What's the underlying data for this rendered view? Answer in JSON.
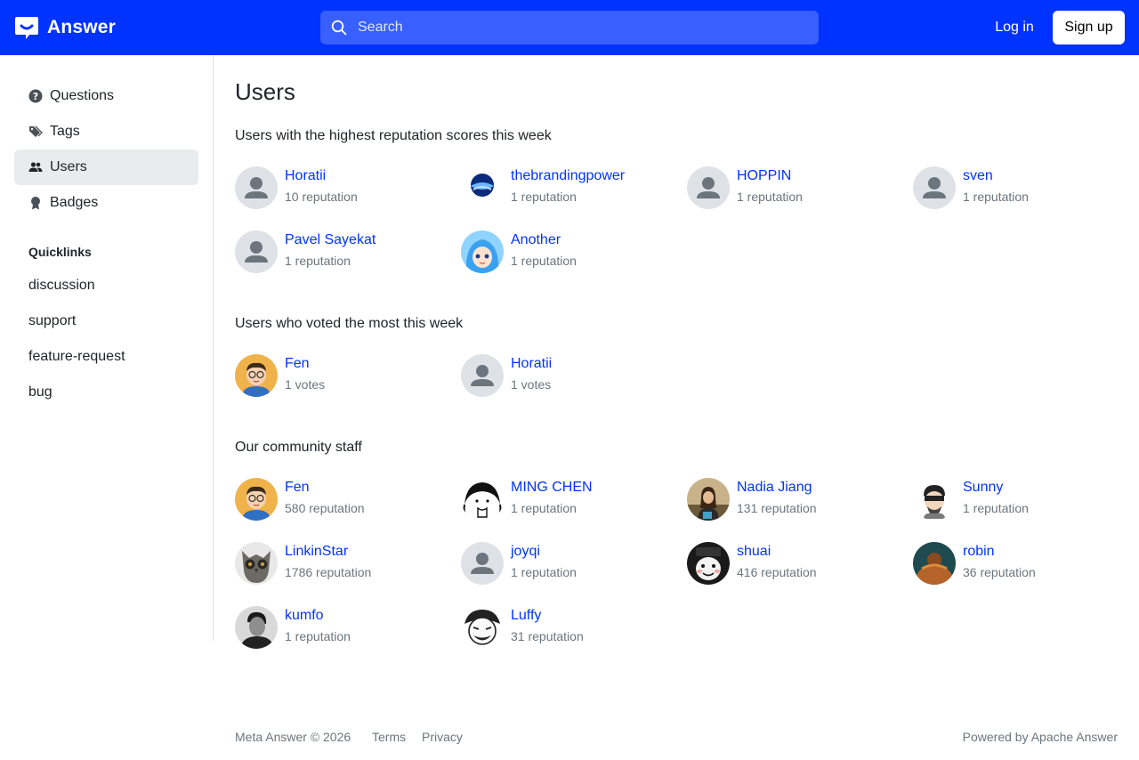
{
  "header": {
    "brand": "Answer",
    "search_placeholder": "Search",
    "login_label": "Log in",
    "signup_label": "Sign up",
    "brand_color": "#0033ff"
  },
  "sidebar": {
    "items": [
      {
        "label": "Questions",
        "icon": "question-circle-icon"
      },
      {
        "label": "Tags",
        "icon": "tags-icon"
      },
      {
        "label": "Users",
        "icon": "people-icon",
        "active": true
      },
      {
        "label": "Badges",
        "icon": "award-icon"
      }
    ],
    "quicklinks_title": "Quicklinks",
    "quicklinks": [
      "discussion",
      "support",
      "feature-request",
      "bug"
    ]
  },
  "main": {
    "title": "Users",
    "reputation_section": {
      "title": "Users with the highest reputation scores this week",
      "users": [
        {
          "name": "Horatii",
          "stat": "10 reputation",
          "avatar": "default-avatar"
        },
        {
          "name": "thebrandingpower",
          "stat": "1 reputation",
          "avatar": "brand-logo-avatar"
        },
        {
          "name": "HOPPIN",
          "stat": "1 reputation",
          "avatar": "default-avatar"
        },
        {
          "name": "sven",
          "stat": "1 reputation",
          "avatar": "default-avatar"
        },
        {
          "name": "Pavel Sayekat",
          "stat": "1 reputation",
          "avatar": "default-avatar"
        },
        {
          "name": "Another",
          "stat": "1 reputation",
          "avatar": "anime-avatar"
        }
      ]
    },
    "votes_section": {
      "title": "Users who voted the most this week",
      "users": [
        {
          "name": "Fen",
          "stat": "1 votes",
          "avatar": "cartoon-avatar"
        },
        {
          "name": "Horatii",
          "stat": "1 votes",
          "avatar": "default-avatar"
        }
      ]
    },
    "staff_section": {
      "title": "Our community staff",
      "users": [
        {
          "name": "Fen",
          "stat": "580 reputation",
          "avatar": "cartoon-avatar"
        },
        {
          "name": "MING CHEN",
          "stat": "1 reputation",
          "avatar": "sketch-avatar"
        },
        {
          "name": "Nadia Jiang",
          "stat": "131 reputation",
          "avatar": "photo-avatar"
        },
        {
          "name": "Sunny",
          "stat": "1 reputation",
          "avatar": "sticker-avatar"
        },
        {
          "name": "LinkinStar",
          "stat": "1786 reputation",
          "avatar": "owl-avatar"
        },
        {
          "name": "joyqi",
          "stat": "1 reputation",
          "avatar": "default-avatar"
        },
        {
          "name": "shuai",
          "stat": "416 reputation",
          "avatar": "meme-avatar"
        },
        {
          "name": "robin",
          "stat": "36 reputation",
          "avatar": "photo-avatar"
        },
        {
          "name": "kumfo",
          "stat": "1 reputation",
          "avatar": "photo-avatar"
        },
        {
          "name": "Luffy",
          "stat": "31 reputation",
          "avatar": "luffy-avatar"
        }
      ]
    }
  },
  "footer": {
    "copyright": "Meta Answer © 2026",
    "terms": "Terms",
    "privacy": "Privacy",
    "powered_by": "Powered by Apache Answer"
  }
}
